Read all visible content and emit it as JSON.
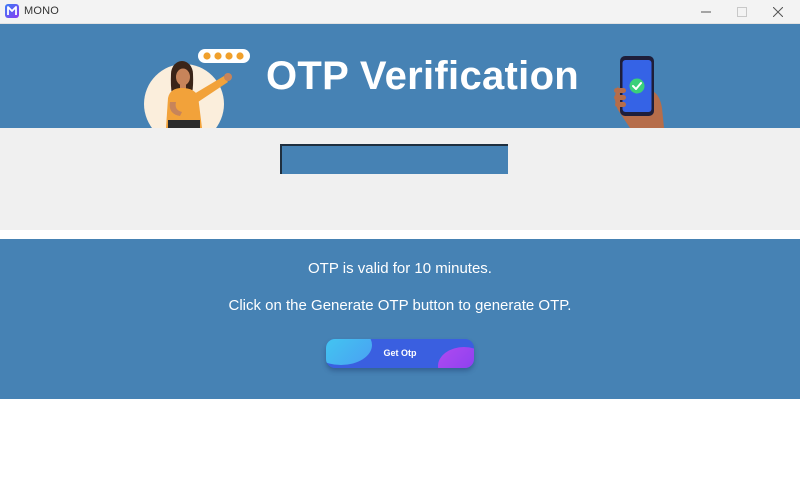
{
  "window": {
    "title": "MONO",
    "controls": [
      "minimize",
      "maximize",
      "close"
    ]
  },
  "header": {
    "title": "OTP Verification",
    "illustrations": [
      "woman-pointing-icon",
      "phone-check-icon"
    ]
  },
  "otp_input": {
    "value": "",
    "placeholder": ""
  },
  "info": {
    "validity_text": "OTP is valid for 10 minutes.",
    "instruction_text": "Click on the Generate OTP button to generate OTP."
  },
  "actions": {
    "get_otp_label": "Get Otp"
  },
  "colors": {
    "panel_blue": "#4682b4",
    "input_section_bg": "#f0f0f0",
    "button_blue": "#3a5fe0",
    "button_cyan": "#3fd4f0",
    "button_purple": "#b04af0"
  }
}
